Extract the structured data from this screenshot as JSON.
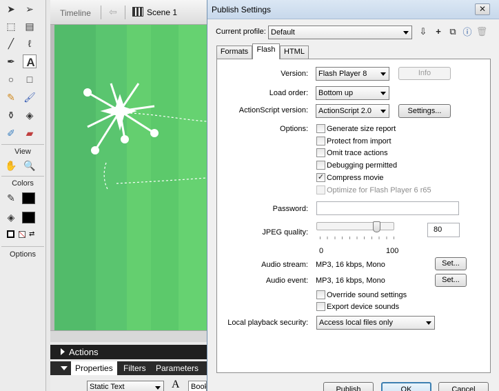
{
  "tools": {
    "sections": {
      "view": "View",
      "colors": "Colors",
      "options": "Options"
    }
  },
  "stage": {
    "timeline_label": "Timeline",
    "scene_label": "Scene 1",
    "actions_label": "Actions",
    "prop_tabs": [
      "Properties",
      "Filters",
      "Parameters"
    ],
    "text_type": "Static Text",
    "font_partial": "Book"
  },
  "dialog": {
    "title": "Publish Settings",
    "close_symbol": "✕",
    "profile_label": "Current profile:",
    "profile_value": "Default",
    "tabs": [
      "Formats",
      "Flash",
      "HTML"
    ],
    "version_label": "Version:",
    "version_value": "Flash Player 8",
    "info_button": "Info",
    "load_order_label": "Load order:",
    "load_order_value": "Bottom up",
    "as_version_label": "ActionScript version:",
    "as_version_value": "ActionScript 2.0",
    "settings_button": "Settings...",
    "options_label": "Options:",
    "options": [
      {
        "label": "Generate size report",
        "checked": false,
        "enabled": true
      },
      {
        "label": "Protect from import",
        "checked": false,
        "enabled": true
      },
      {
        "label": "Omit trace actions",
        "checked": false,
        "enabled": true
      },
      {
        "label": "Debugging permitted",
        "checked": false,
        "enabled": true
      },
      {
        "label": "Compress movie",
        "checked": true,
        "enabled": true
      },
      {
        "label": "Optimize for Flash Player 6 r65",
        "checked": false,
        "enabled": false
      }
    ],
    "password_label": "Password:",
    "password_value": "",
    "jpeg_label": "JPEG quality:",
    "jpeg_value": "80",
    "jpeg_quality": 80,
    "slider_min": "0",
    "slider_max": "100",
    "audio_stream_label": "Audio stream:",
    "audio_stream_value": "MP3, 16 kbps, Mono",
    "audio_event_label": "Audio event:",
    "audio_event_value": "MP3, 16 kbps, Mono",
    "set_button": "Set...",
    "sound_options": [
      {
        "label": "Override sound settings",
        "checked": false
      },
      {
        "label": "Export device sounds",
        "checked": false
      }
    ],
    "security_label": "Local playback security:",
    "security_value": "Access local files only",
    "footer_buttons": [
      "Publish",
      "OK",
      "Cancel"
    ]
  },
  "colors": {
    "stage_green": "#5bc86a",
    "title_blue": "#c7d8eb",
    "ok_blue": "#3c7fb1"
  }
}
